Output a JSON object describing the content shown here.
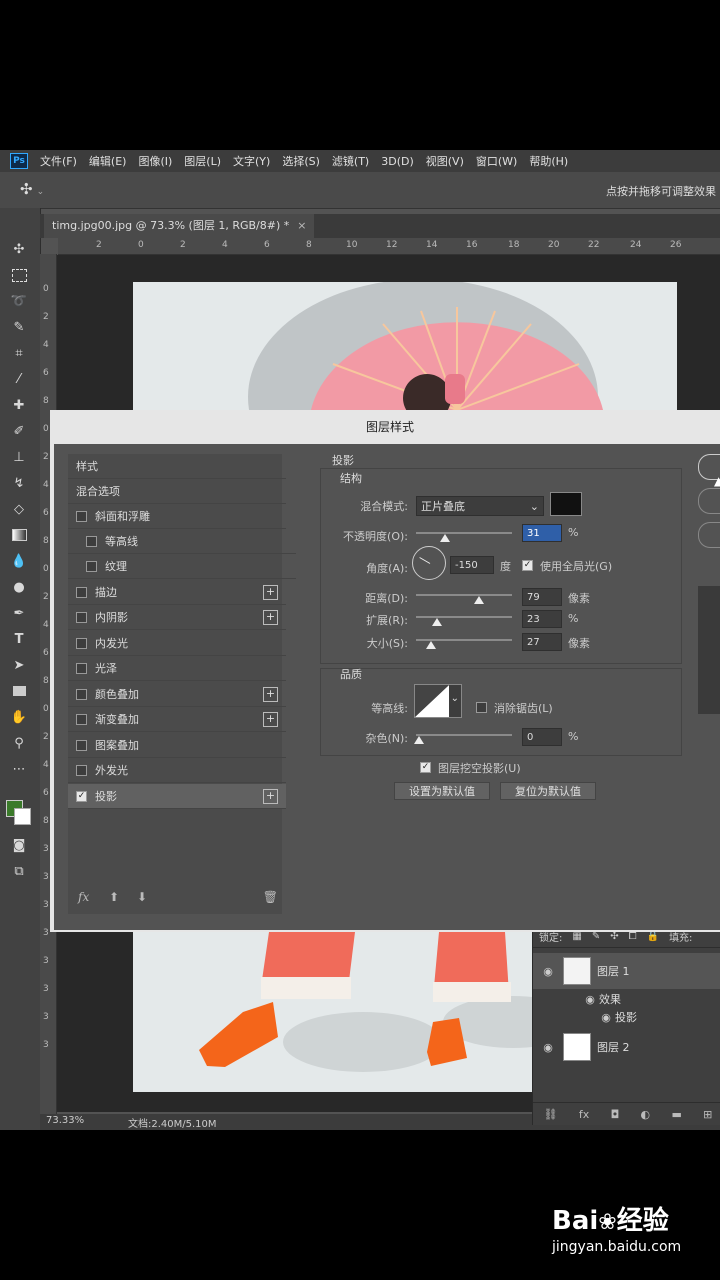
{
  "menubar": {
    "app_icon": "Ps",
    "items": [
      "文件(F)",
      "编辑(E)",
      "图像(I)",
      "图层(L)",
      "文字(Y)",
      "选择(S)",
      "滤镜(T)",
      "3D(D)",
      "视图(V)",
      "窗口(W)",
      "帮助(H)"
    ]
  },
  "options_bar": {
    "hint": "点按并拖移可调整效果"
  },
  "document": {
    "tab_title": "timg.jpg00.jpg @ 73.3% (图层 1, RGB/8#) *",
    "tab_close": "×",
    "ruler_top": [
      "2",
      "0",
      "2",
      "4",
      "6",
      "8",
      "10",
      "12",
      "14",
      "16",
      "18",
      "20",
      "22",
      "24",
      "26"
    ],
    "ruler_left": [
      "0",
      "2",
      "4",
      "6",
      "8",
      "0",
      "2",
      "4",
      "6",
      "8",
      "0",
      "2",
      "4",
      "6",
      "8",
      "0",
      "2",
      "4",
      "6",
      "8",
      "3",
      "3",
      "3",
      "3",
      "3",
      "3",
      "3",
      "3"
    ],
    "zoom": "73.33%",
    "doc_info": "文档:2.40M/5.10M"
  },
  "layers_panel": {
    "lock_label": "锁定:",
    "fill_label": "填充:",
    "layers": [
      {
        "name": "图层 1",
        "effects_label": "效果",
        "effect": "投影"
      },
      {
        "name": "图层 2"
      }
    ]
  },
  "dialog": {
    "title": "图层样式",
    "styles": [
      {
        "label": "样式"
      },
      {
        "label": "混合选项"
      },
      {
        "label": "斜面和浮雕",
        "checked": false
      },
      {
        "label": "等高线",
        "checked": false
      },
      {
        "label": "纹理",
        "checked": false
      },
      {
        "label": "描边",
        "checked": false
      },
      {
        "label": "内阴影",
        "checked": false
      },
      {
        "label": "内发光",
        "checked": false
      },
      {
        "label": "光泽",
        "checked": false
      },
      {
        "label": "颜色叠加",
        "checked": false
      },
      {
        "label": "渐变叠加",
        "checked": false
      },
      {
        "label": "图案叠加",
        "checked": false
      },
      {
        "label": "外发光",
        "checked": false
      },
      {
        "label": "投影",
        "checked": true
      }
    ],
    "fx_label": "fx",
    "section_title": "投影",
    "structure": {
      "title": "结构",
      "blend_mode_label": "混合模式:",
      "blend_mode": "正片叠底",
      "blend_color": "#111111",
      "opacity_label": "不透明度(O):",
      "opacity": "31",
      "opacity_unit": "%",
      "angle_label": "角度(A):",
      "angle": "-150",
      "angle_unit": "度",
      "global_light_label": "使用全局光(G)",
      "global_light": true,
      "distance_label": "距离(D):",
      "distance": "79",
      "distance_unit": "像素",
      "spread_label": "扩展(R):",
      "spread": "23",
      "spread_unit": "%",
      "size_label": "大小(S):",
      "size": "27",
      "size_unit": "像素"
    },
    "quality": {
      "title": "品质",
      "contour_label": "等高线:",
      "antialias_label": "消除锯齿(L)",
      "antialias": false,
      "noise_label": "杂色(N):",
      "noise": "0",
      "noise_unit": "%"
    },
    "knockout_label": "图层挖空投影(U)",
    "knockout": true,
    "set_default_label": "设置为默认值",
    "reset_default_label": "复位为默认值"
  },
  "watermark": {
    "brand": "Bai",
    "brand_cn": "经验",
    "url": "jingyan.baidu.com"
  }
}
